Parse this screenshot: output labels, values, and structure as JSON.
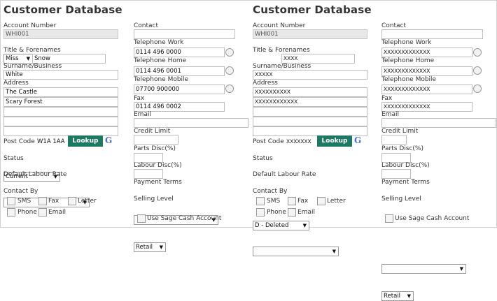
{
  "left": {
    "title": "Customer Database",
    "account_number_label": "Account Number",
    "account_number": "WHI001",
    "title_forenames_label": "Title & Forenames",
    "title_value": "Miss",
    "forenames": "Snow",
    "surname_label": "Surname/Business",
    "surname": "White",
    "address_label": "Address",
    "address_lines": [
      "The Castle",
      "Scary Forest",
      "",
      "",
      ""
    ],
    "postcode_label": "Post Code",
    "postcode": "W1A 1AA",
    "lookup_label": "Lookup",
    "g_icon_text": "G",
    "status_label": "Status",
    "status_value": "Current",
    "default_labour_label": "Default Labour Rate",
    "default_labour_value": "",
    "contact_by_label": "Contact By",
    "sms_label": "SMS",
    "fax_label": "Fax",
    "letter_label": "Letter",
    "phone_label": "Phone",
    "email_label": "Email",
    "contact_label": "Contact",
    "contact": "",
    "tel_work_label": "Telephone Work",
    "tel_work": "0114 496 0000",
    "tel_home_label": "Telephone Home",
    "tel_home": "0114 496 0001",
    "tel_mobile_label": "Telephone Mobile",
    "tel_mobile": "07700 900000",
    "fax_field_label": "Fax",
    "fax_value": "0114 496 0002",
    "email_field_label": "Email",
    "email_value": "",
    "credit_limit_label": "Credit Limit",
    "parts_disc_label": "Parts Disc(%)",
    "labour_disc_label": "Labour Disc(%)",
    "payment_terms_label": "Payment Terms",
    "payment_terms_value": "",
    "selling_level_label": "Selling Level",
    "selling_level_value": "Retail",
    "sage_label": "Use Sage Cash Account"
  },
  "right": {
    "title": "Customer Database",
    "account_number_label": "Account Number",
    "account_number": "WHI001",
    "title_forenames_label": "Title & Forenames",
    "title_value": "",
    "forenames": "XXXX",
    "surname_label": "Surname/Business",
    "surname": "XXXXX",
    "address_label": "Address",
    "address_lines": [
      "XXXXXXXXXX",
      "XXXXXXXXXXXX",
      "",
      "",
      ""
    ],
    "postcode_label": "Post Code",
    "postcode": "XXXXXXX",
    "lookup_label": "Lookup",
    "g_icon_text": "G",
    "status_label": "Status",
    "status_value": "D - Deleted",
    "default_labour_label": "Default Labour Rate",
    "default_labour_value": "",
    "contact_by_label": "Contact By",
    "sms_label": "SMS",
    "fax_label": "Fax",
    "letter_label": "Letter",
    "phone_label": "Phone",
    "email_label": "Email",
    "contact_label": "Contact",
    "contact": "",
    "tel_work_label": "Telephone Work",
    "tel_work": "XXXXXXXXXXXXX",
    "tel_home_label": "Telephone Home",
    "tel_home": "XXXXXXXXXXXXX",
    "tel_mobile_label": "Telephone Mobile",
    "tel_mobile": "XXXXXXXXXXXXX",
    "fax_field_label": "Fax",
    "fax_value": "XXXXXXXXXXXXX",
    "email_field_label": "Email",
    "email_value": "",
    "credit_limit_label": "Credit Limit",
    "parts_disc_label": "Parts Disc(%)",
    "labour_disc_label": "Labour Disc(%)",
    "payment_terms_label": "Payment Terms",
    "payment_terms_value": "",
    "selling_level_label": "Selling Level",
    "selling_level_value": "Retail",
    "sage_label": "Use Sage Cash Account"
  }
}
